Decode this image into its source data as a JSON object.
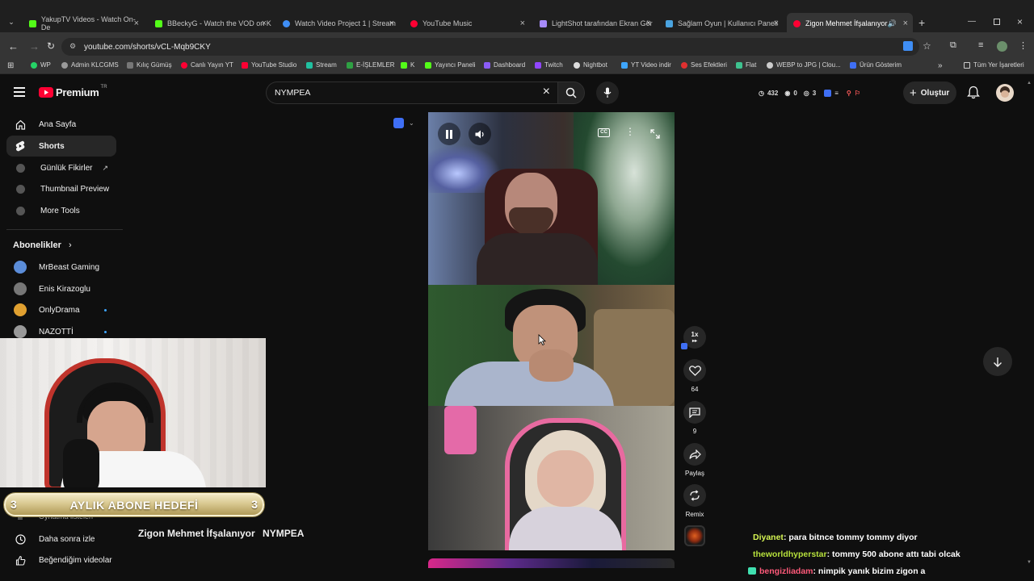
{
  "browser": {
    "tabs": [
      {
        "title": "YakupTV Videos - Watch On-De",
        "color": "#53fc18"
      },
      {
        "title": "BBeckyG - Watch the VOD on K",
        "color": "#53fc18"
      },
      {
        "title": "Watch Video Project 1 | Stream",
        "color": "#3f8ef5"
      },
      {
        "title": "YouTube Music",
        "color": "#ff0033"
      },
      {
        "title": "LightShot tarafından Ekran Gör",
        "color": "#a78bfa"
      },
      {
        "title": "Sağlam Oyun | Kullanıcı Paneli",
        "color": "#4aa3df"
      },
      {
        "title": "Zigon Mehmet İfşalanıyor",
        "color": "#ff0033"
      }
    ],
    "url": "youtube.com/shorts/vCL-Mqb9CKY",
    "bookmarks": [
      "WP",
      "Admin KLCGMS",
      "Kılıç Gümüş",
      "Canlı Yayın YT",
      "YouTube Studio",
      "Stream",
      "E-İŞLEMLER",
      "K",
      "Yayıncı Paneli",
      "Dashboard",
      "Twitch",
      "Nightbot",
      "YT Video indir",
      "Ses Efektleri",
      "Flat",
      "WEBP to JPG | Clou...",
      "Ürün Gösterim"
    ],
    "all_bookmarks": "Tüm Yer İşaretleri"
  },
  "youtube": {
    "logo_text": "Premium",
    "logo_badge": "TR",
    "search_value": "NYMPEA",
    "create_label": "Oluştur",
    "stats": {
      "views": "432",
      "a": "0",
      "b": "3"
    },
    "sidebar": {
      "items": [
        "Ana Sayfa",
        "Shorts",
        "Günlük Fikirler",
        "Thumbnail Preview",
        "More Tools"
      ],
      "subs_title": "Abonelikler",
      "subs": [
        "MrBeast Gaming",
        "Enis Kirazoglu",
        "OnlyDrama",
        "NAZOTTİ"
      ],
      "bottom": [
        "Oynatma listeleri",
        "Daha sonra izle",
        "Beğendiğim videolar"
      ]
    },
    "short": {
      "title": "Zigon Mehmet İfşalanıyor",
      "tag": "NYMPEA",
      "speed": "1x",
      "likes": "64",
      "comments": "9",
      "share": "Paylaş",
      "remix": "Remix"
    }
  },
  "overlay": {
    "goal_label": "AYLIK ABONE HEDEFİ",
    "goal_left": "3",
    "goal_right": "3"
  },
  "chat": [
    {
      "user": "Diyanet",
      "msg": ": para bitnce tommy tommy diyor",
      "color": "#d6f553"
    },
    {
      "user": "theworldhyperstar",
      "msg": ": tommy 500 abone attı tabi olcak",
      "color": "#b7e23c"
    },
    {
      "user": "bengizliadam",
      "msg": ": nimpik yanık bizim zigon a",
      "color": "#ff5a7a"
    }
  ]
}
